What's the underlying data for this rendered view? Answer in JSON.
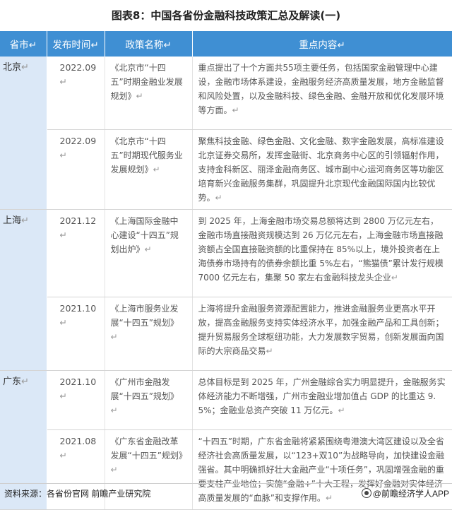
{
  "title": "图表8：中国各省份金融科技政策汇总及解读(一)",
  "headers": {
    "province": "省市",
    "date": "发布时间",
    "policy": "政策名称",
    "content": "重点内容"
  },
  "return_mark": "↵",
  "rows": [
    {
      "province": "北京",
      "date": "2022.09",
      "policy": "《北京市“十四五”时期金融业发展规划》",
      "content": "重点提出了十个方面共55项主要任务，包括国家金融管理中心建设，金融市场体系建设，金融服务经济高质量发展，地方金融监督和风险处置，以及金融科技、绿色金融、金融开放和优化发展环境等方面。"
    },
    {
      "province": "",
      "date": "2022.09",
      "policy": "《北京市“十四五”时期现代服务业发展规划》",
      "content": "聚焦科技金融、绿色金融、文化金融、数字金融发展，高标准建设北京证券交易所，发挥金融街、北京商务中心区的引领辐射作用，支持金科新区、丽泽金融商务区、城市副中心运河商务区等功能区培育新兴金融服务集群，巩固提升北京现代金融国际国内比较优势。"
    },
    {
      "province": "上海",
      "date": "2021.12",
      "policy": "《上海国际金融中心建设“十四五”规划出炉》",
      "content": "到 2025 年，上海金融市场交易总额将达到 2800 万亿元左右，金融市场直接融资规模达到 26 万亿元左右，上海金融市场直接融资额占全国直接融资额的比重保持在 85%以上，境外投资者在上海债券市场持有的债券余额比重 5%左右，“熊猫债”累计发行规模 7000 亿元左右，集聚 50 家左右金融科技龙头企业"
    },
    {
      "province": "",
      "date": "2021.10",
      "policy": "《上海市服务业发展“十四五”规划》",
      "content": "上海将提升金融服务资源配置能力，推进金融服务业更高水平开放，提高金融服务支持实体经济水平，加强金融产品和工具创新；提升贸易服务全球枢纽功能，大力发展数字贸易，创新发展面向国际的大宗商品交易"
    },
    {
      "province": "广东",
      "date": "2021.10",
      "policy": "《广州市金融发展“十四五”规划》",
      "content": "总体目标是到 2025 年，广州金融综合实力明显提升，金融服务实体经济能力不断增强，广州市金融业增加值占 GDP 的比重达 9.5%；金融业总资产突破 11 万亿元。"
    },
    {
      "province": "",
      "date": "2021.08",
      "policy": "《广东省金融改革发展“十四五”规划》",
      "content": "“十四五”时期，广东省金融将紧紧围绕粤港澳大湾区建设以及全省经济社会高质量发展，以“123+双10”为战略导向，加快建设金融强省。其中明确抓好壮大金融产业“十项任务”，巩固增强金融的重要支柱产业地位；实施“金融+”十大工程，发挥好金融对实体经济高质量发展的“血脉”和支撑作用。"
    }
  ],
  "footer": {
    "source": "资料来源：各省份官网 前瞻产业研究院",
    "brand": "@前瞻经济学人APP"
  },
  "colors": {
    "header_bg": "#3f8fd3",
    "province_bg": "#dbe8f7"
  }
}
